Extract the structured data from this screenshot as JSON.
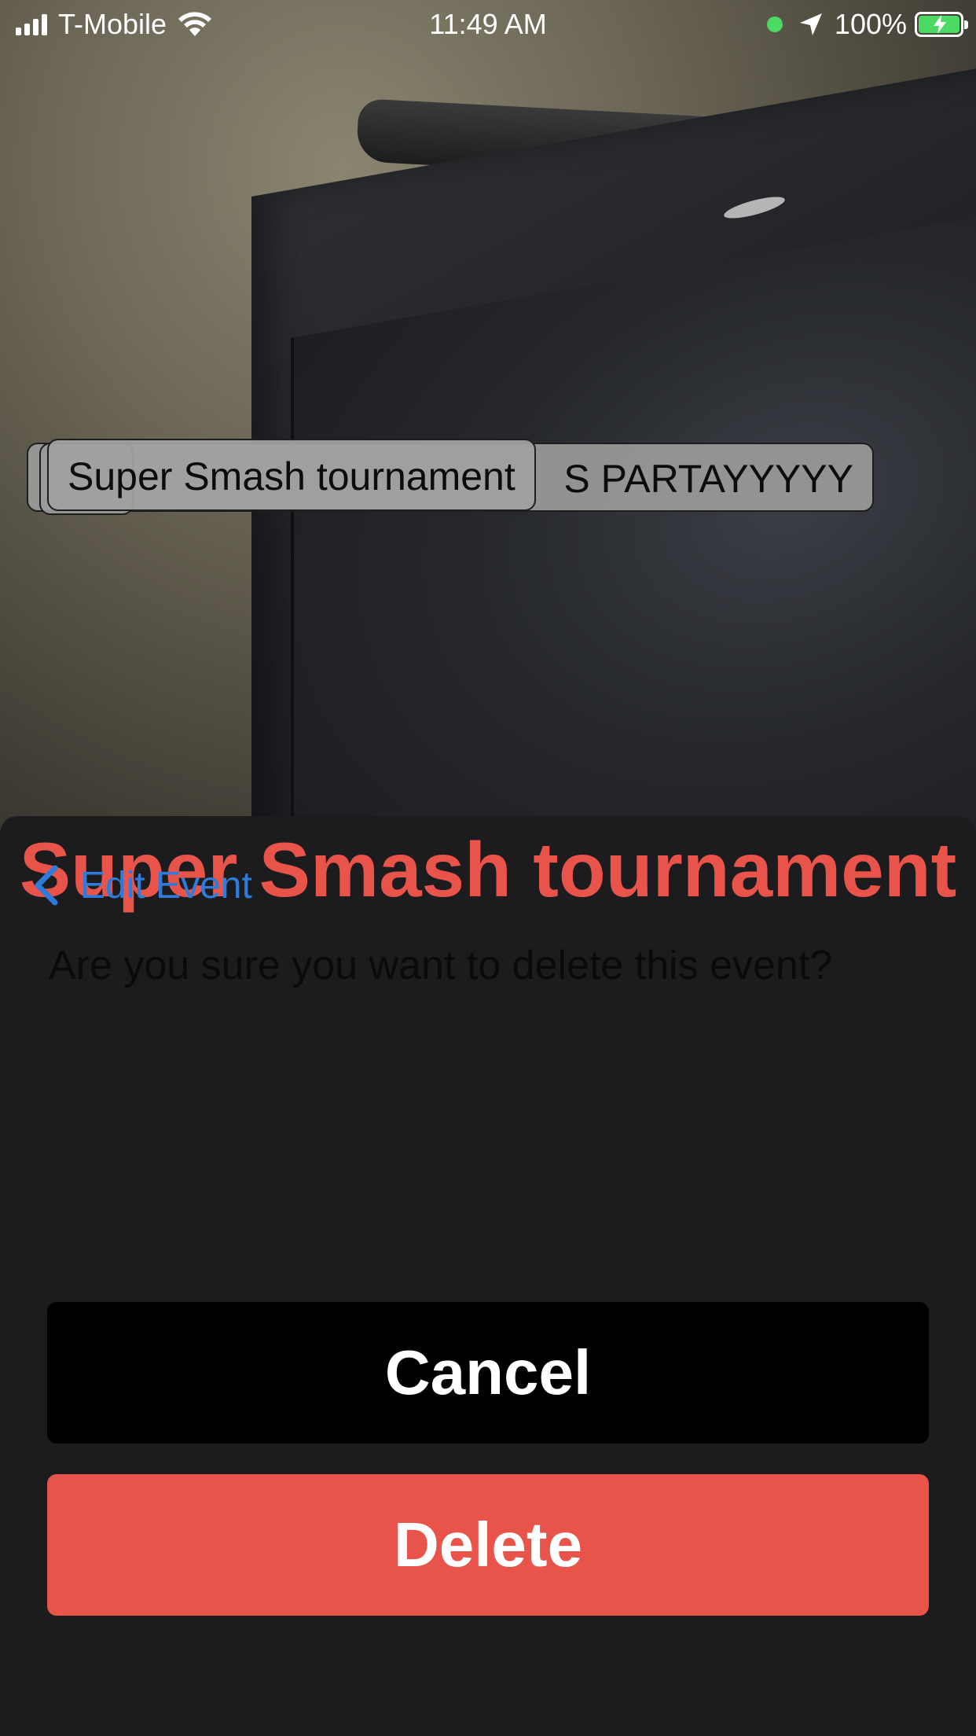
{
  "status_bar": {
    "carrier": "T-Mobile",
    "time": "11:49 AM",
    "battery": "100%"
  },
  "ar_tags": {
    "back_tag": "S PARTAYYYYY",
    "front_tag": "Super Smash tournament"
  },
  "sheet": {
    "title": "Super Smash tournament",
    "back_label": "Edit Event",
    "confirm_text": "Are you sure you want to delete this event?",
    "cancel_label": "Cancel",
    "delete_label": "Delete"
  },
  "colors": {
    "accent_red": "#e8534a",
    "link_blue": "#2f7bd9",
    "sheet_bg": "#1c1c1e"
  }
}
